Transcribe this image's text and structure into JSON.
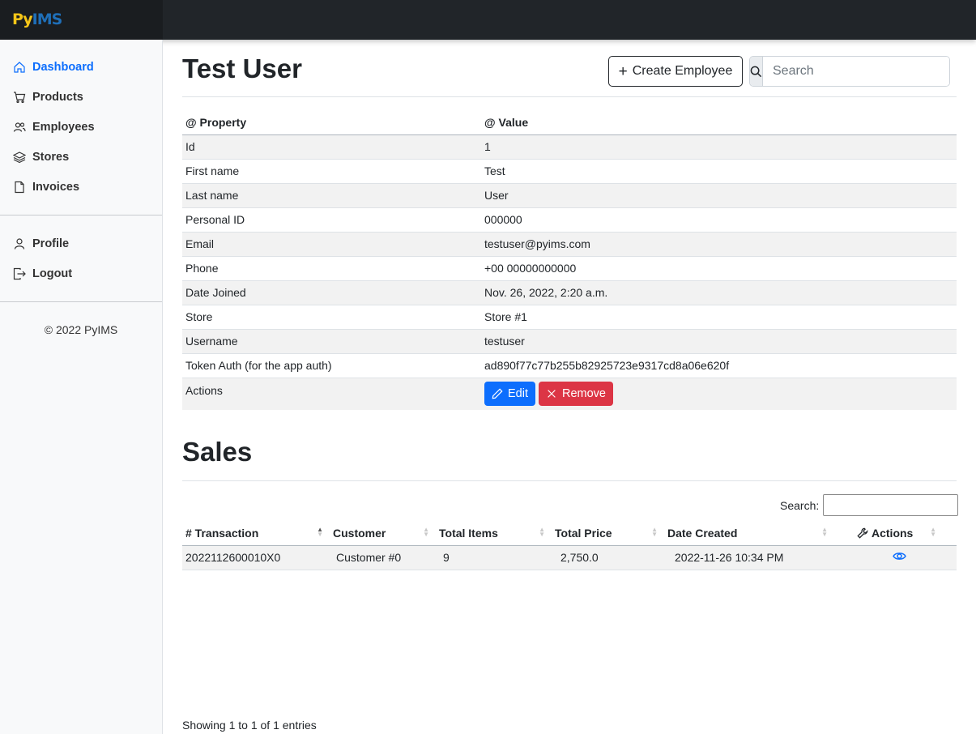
{
  "brand": {
    "part1": "Py",
    "part2": "IMS"
  },
  "sidebar": {
    "items": [
      {
        "label": "Dashboard",
        "icon": "home-icon"
      },
      {
        "label": "Products",
        "icon": "cart-icon"
      },
      {
        "label": "Employees",
        "icon": "people-icon"
      },
      {
        "label": "Stores",
        "icon": "layers-icon"
      },
      {
        "label": "Invoices",
        "icon": "file-icon"
      }
    ],
    "secondary": [
      {
        "label": "Profile",
        "icon": "person-icon"
      },
      {
        "label": "Logout",
        "icon": "logout-icon"
      }
    ],
    "copyright": "© 2022 PyIMS",
    "active_color": "#0d6efd"
  },
  "header": {
    "title": "Test User",
    "create_label": "Create Employee",
    "search_placeholder": "Search"
  },
  "details": {
    "col_property": "@ Property",
    "col_value": "@ Value",
    "rows": [
      {
        "property": "Id",
        "value": "1"
      },
      {
        "property": "First name",
        "value": "Test"
      },
      {
        "property": "Last name",
        "value": "User"
      },
      {
        "property": "Personal ID",
        "value": "000000"
      },
      {
        "property": "Email",
        "value": "testuser@pyims.com"
      },
      {
        "property": "Phone",
        "value": "+00 00000000000"
      },
      {
        "property": "Date Joined",
        "value": "Nov. 26, 2022, 2:20 a.m."
      },
      {
        "property": "Store",
        "value": "Store #1"
      },
      {
        "property": "Username",
        "value": "testuser"
      },
      {
        "property": "Token Auth (for the app auth)",
        "value": "ad890f77c77b255b82925723e9317cd8a06e620f"
      }
    ],
    "actions_label": "Actions",
    "edit_label": "Edit",
    "remove_label": "Remove",
    "edit_color": "#0d6efd",
    "remove_color": "#dc3545"
  },
  "sales": {
    "title": "Sales",
    "search_label": "Search:",
    "columns": [
      "# Transaction",
      "Customer",
      "Total Items",
      "Total Price",
      "Date Created",
      "Actions"
    ],
    "rows": [
      {
        "transaction": "2022112600010X0",
        "customer": "Customer #0",
        "items": "9",
        "price": "2,750.0",
        "date": "2022-11-26 10:34 PM"
      }
    ],
    "info": "Showing 1 to 1 of 1 entries"
  }
}
